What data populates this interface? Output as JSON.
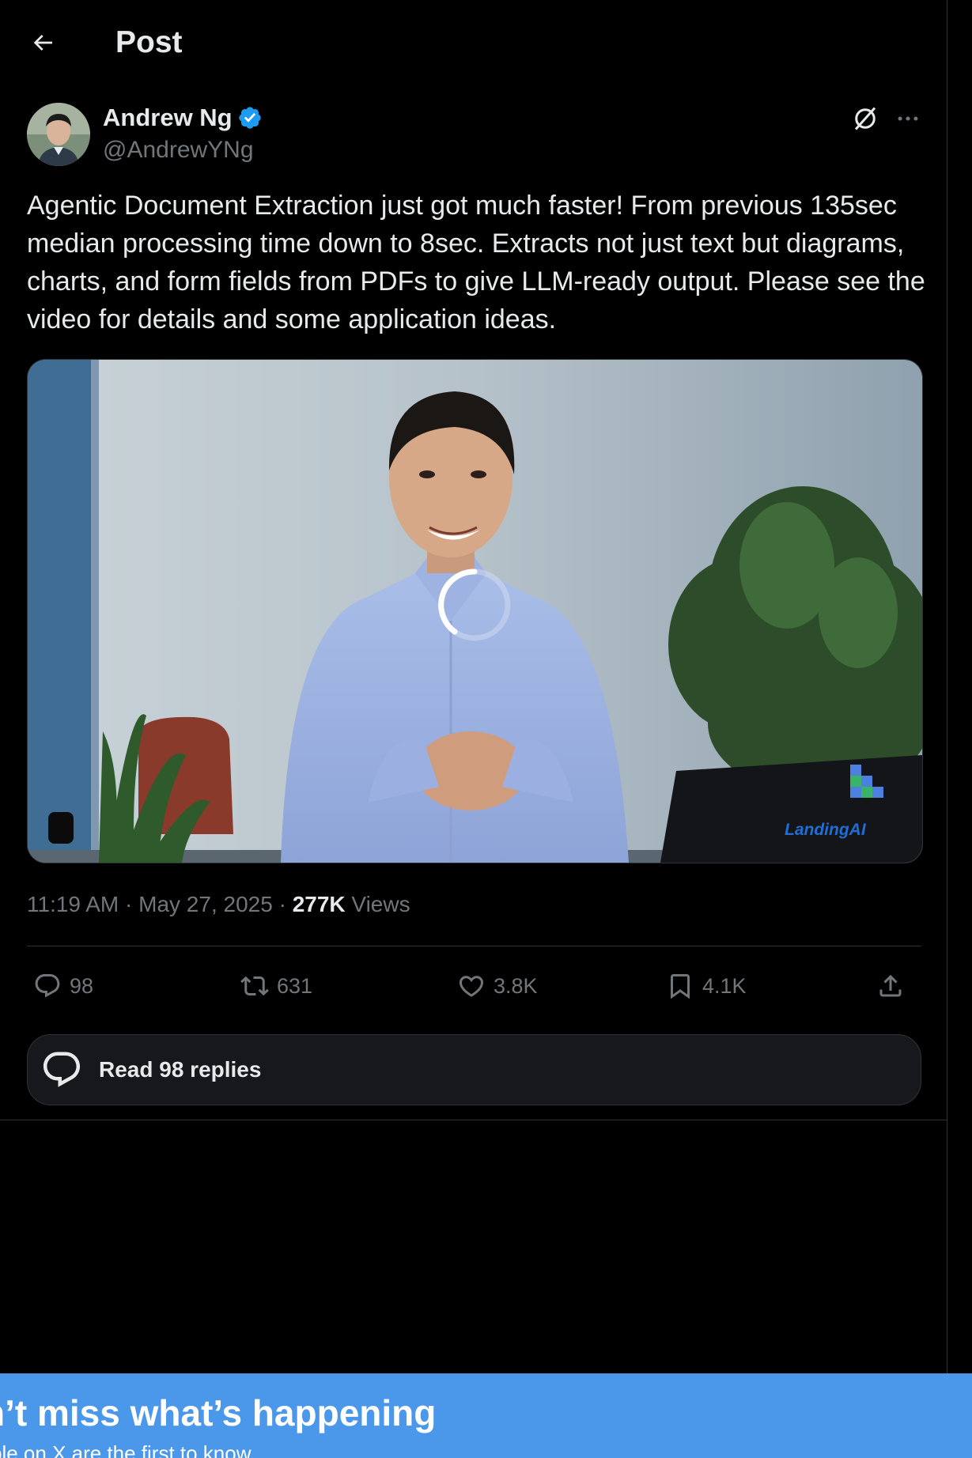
{
  "header": {
    "title": "Post"
  },
  "post": {
    "author_name": "Andrew Ng",
    "handle": "@AndrewYNg",
    "text": "Agentic Document Extraction just got much faster! From previous 135sec median processing time down to 8sec. Extracts not just text but diagrams, charts, and form fields from PDFs to give LLM-ready output. Please see the video for details and some application ideas.",
    "media": {
      "brand_label": "LandingAI",
      "state": "loading"
    },
    "time": "11:19 AM",
    "date": "May 27, 2025",
    "views_count": "277K",
    "views_label": "Views"
  },
  "actions": {
    "replies": "98",
    "reposts": "631",
    "likes": "3.8K",
    "bookmarks": "4.1K"
  },
  "read_replies_label": "Read 98 replies",
  "banner": {
    "title": "n’t miss what’s happening",
    "subtitle": "ple on X are the first to know."
  },
  "colors": {
    "background": "#000000",
    "text_primary": "#e7e9ea",
    "text_secondary": "#71767b",
    "verified": "#1d9bf0",
    "banner": "#4b98ea"
  }
}
